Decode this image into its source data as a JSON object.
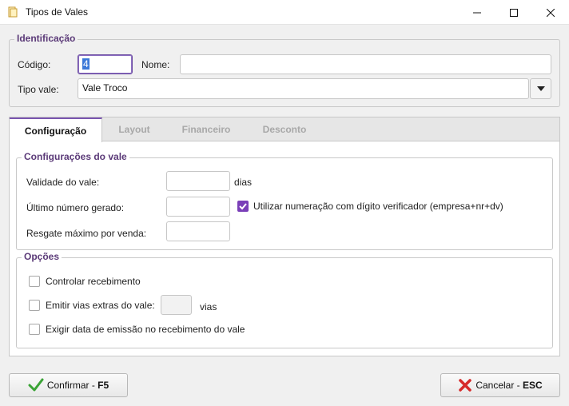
{
  "window": {
    "title": "Tipos de Vales",
    "icons": {
      "app": "voucher-icon",
      "minimize": "minimize-icon",
      "maximize": "maximize-icon",
      "close": "close-icon"
    }
  },
  "identificacao": {
    "legend": "Identificação",
    "codigo_label": "Código:",
    "codigo_value": "4",
    "nome_label": "Nome:",
    "nome_value": "",
    "tipo_label": "Tipo vale:",
    "tipo_value": "Vale Troco"
  },
  "tabs": [
    {
      "label": "Configuração",
      "active": true
    },
    {
      "label": "Layout",
      "active": false
    },
    {
      "label": "Financeiro",
      "active": false
    },
    {
      "label": "Desconto",
      "active": false
    }
  ],
  "config": {
    "legend": "Configurações do vale",
    "validade_label": "Validade do vale:",
    "validade_value": "",
    "dias_label": "dias",
    "ultimo_label": "Último número gerado:",
    "ultimo_value": "",
    "digito_label": "Utilizar numeração com dígito verificador (empresa+nr+dv)",
    "digito_checked": true,
    "resgate_label": "Resgate máximo por venda:",
    "resgate_value": ""
  },
  "opcoes": {
    "legend": "Opções",
    "controlar_label": "Controlar recebimento",
    "controlar_checked": false,
    "emitir_label": "Emitir vias extras do vale:",
    "emitir_checked": false,
    "vias_value": "",
    "vias_label": "vias",
    "exigir_label": "Exigir data de emissão no recebimento do vale",
    "exigir_checked": false
  },
  "buttons": {
    "confirm_label": "Confirmar - ",
    "confirm_key": "F5",
    "cancel_label": "Cancelar - ",
    "cancel_key": "ESC"
  },
  "colors": {
    "accent": "#7a3fb8",
    "legend": "#5b3a78",
    "confirm": "#3aa335",
    "cancel": "#d62b2b"
  }
}
